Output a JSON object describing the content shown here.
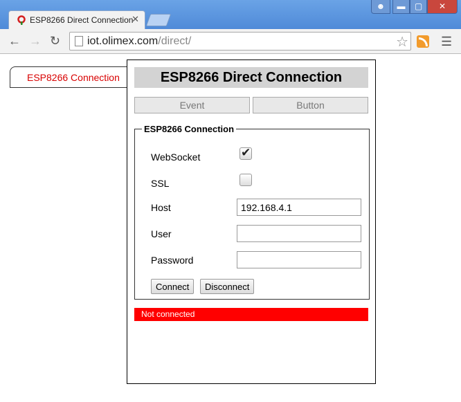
{
  "browser": {
    "tab_title": "ESP8266 Direct Connection",
    "url_host": "iot.olimex.com",
    "url_path": "/direct/"
  },
  "side_tab": {
    "label": "ESP8266 Connection"
  },
  "page": {
    "title": "ESP8266 Direct Connection",
    "tabs": [
      "Event",
      "Button"
    ]
  },
  "connection": {
    "legend": "ESP8266 Connection",
    "websocket_label": "WebSocket",
    "websocket_checked": true,
    "ssl_label": "SSL",
    "ssl_checked": false,
    "host_label": "Host",
    "host_value": "192.168.4.1",
    "user_label": "User",
    "user_value": "",
    "password_label": "Password",
    "password_value": "",
    "connect_label": "Connect",
    "disconnect_label": "Disconnect"
  },
  "status": {
    "text": "Not connected",
    "color": "#ff0000"
  }
}
